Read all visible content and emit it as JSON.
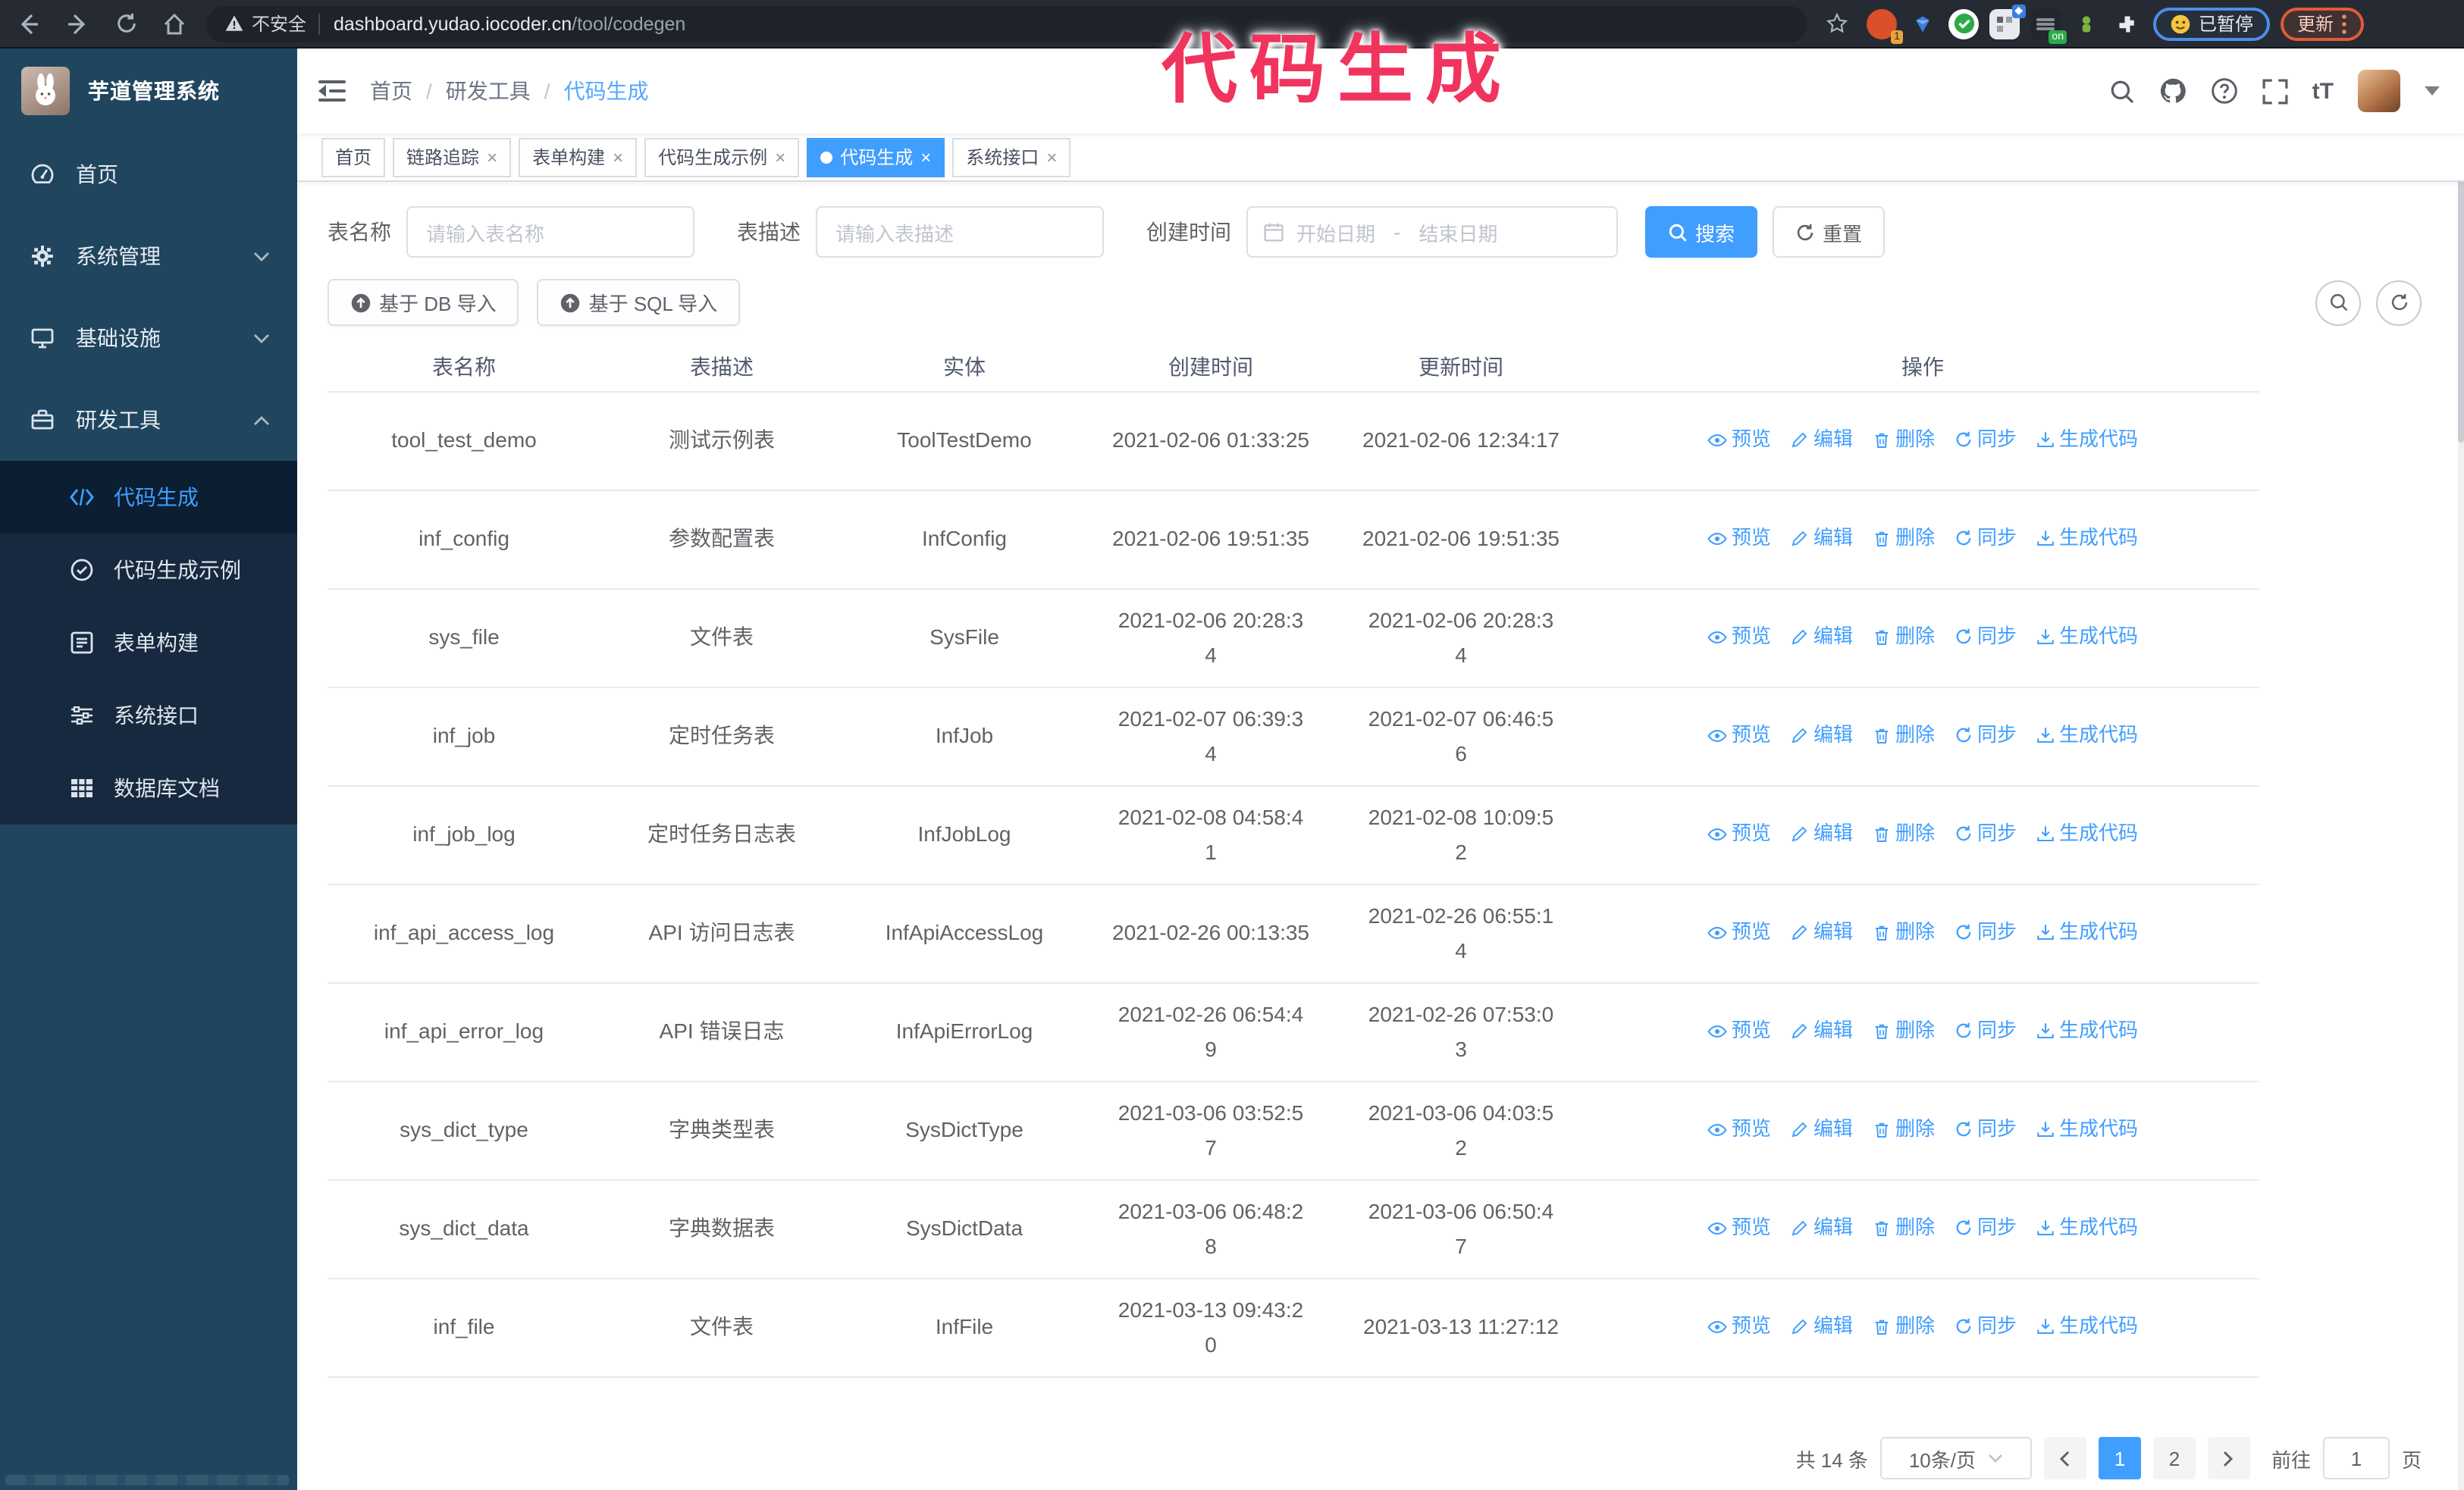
{
  "browser": {
    "security_label": "不安全",
    "url_domain": "dashboard.yudao.iocoder.cn",
    "url_path": "/tool/codegen",
    "ext_badge_count": "1",
    "ext_badge_on": "on",
    "paused_label": "已暂停",
    "update_label": "更新"
  },
  "annotation": {
    "text": "代码生成",
    "color": "#f0345e"
  },
  "app": {
    "title": "芋道管理系统"
  },
  "breadcrumb": [
    "首页",
    "研发工具",
    "代码生成"
  ],
  "sidebar": {
    "items": [
      {
        "label": "首页"
      },
      {
        "label": "系统管理",
        "state": "collapsed"
      },
      {
        "label": "基础设施",
        "state": "collapsed"
      },
      {
        "label": "研发工具",
        "state": "expanded"
      }
    ],
    "submenu": [
      "代码生成",
      "代码生成示例",
      "表单构建",
      "系统接口",
      "数据库文档"
    ],
    "active_submenu": "代码生成"
  },
  "tabs": [
    {
      "label": "首页",
      "closable": false,
      "active": false
    },
    {
      "label": "链路追踪",
      "closable": true,
      "active": false
    },
    {
      "label": "表单构建",
      "closable": true,
      "active": false
    },
    {
      "label": "代码生成示例",
      "closable": true,
      "active": false
    },
    {
      "label": "代码生成",
      "closable": true,
      "active": true
    },
    {
      "label": "系统接口",
      "closable": true,
      "active": false
    }
  ],
  "filters": {
    "table_name_label": "表名称",
    "table_name_placeholder": "请输入表名称",
    "table_desc_label": "表描述",
    "table_desc_placeholder": "请输入表描述",
    "create_time_label": "创建时间",
    "start_placeholder": "开始日期",
    "range_separator": "-",
    "end_placeholder": "结束日期",
    "search_label": "搜索",
    "reset_label": "重置"
  },
  "toolbar": {
    "import_db": "基于 DB 导入",
    "import_sql": "基于 SQL 导入"
  },
  "table": {
    "columns": [
      "表名称",
      "表描述",
      "实体",
      "创建时间",
      "更新时间",
      "操作"
    ],
    "actions": [
      "预览",
      "编辑",
      "删除",
      "同步",
      "生成代码"
    ],
    "rows": [
      {
        "name": "tool_test_demo",
        "desc": "测试示例表",
        "entity": "ToolTestDemo",
        "created": "2021-02-06 01:33:25",
        "updated": "2021-02-06 12:34:17"
      },
      {
        "name": "inf_config",
        "desc": "参数配置表",
        "entity": "InfConfig",
        "created": "2021-02-06 19:51:35",
        "updated": "2021-02-06 19:51:35"
      },
      {
        "name": "sys_file",
        "desc": "文件表",
        "entity": "SysFile",
        "created": "2021-02-06 20:28:34",
        "updated": "2021-02-06 20:28:34"
      },
      {
        "name": "inf_job",
        "desc": "定时任务表",
        "entity": "InfJob",
        "created": "2021-02-07 06:39:34",
        "updated": "2021-02-07 06:46:56"
      },
      {
        "name": "inf_job_log",
        "desc": "定时任务日志表",
        "entity": "InfJobLog",
        "created": "2021-02-08 04:58:41",
        "updated": "2021-02-08 10:09:52"
      },
      {
        "name": "inf_api_access_log",
        "desc": "API 访问日志表",
        "entity": "InfApiAccessLog",
        "created": "2021-02-26 00:13:35",
        "updated": "2021-02-26 06:55:14"
      },
      {
        "name": "inf_api_error_log",
        "desc": "API 错误日志",
        "entity": "InfApiErrorLog",
        "created": "2021-02-26 06:54:49",
        "updated": "2021-02-26 07:53:03"
      },
      {
        "name": "sys_dict_type",
        "desc": "字典类型表",
        "entity": "SysDictType",
        "created": "2021-03-06 03:52:57",
        "updated": "2021-03-06 04:03:52"
      },
      {
        "name": "sys_dict_data",
        "desc": "字典数据表",
        "entity": "SysDictData",
        "created": "2021-03-06 06:48:28",
        "updated": "2021-03-06 06:50:47"
      },
      {
        "name": "inf_file",
        "desc": "文件表",
        "entity": "InfFile",
        "created": "2021-03-13 09:43:20",
        "updated": "2021-03-13 11:27:12"
      }
    ]
  },
  "pagination": {
    "total_label": "共 14 条",
    "page_size_label": "10条/页",
    "pages": [
      "1",
      "2"
    ],
    "active_page": "1",
    "goto_label": "前往",
    "goto_value": "1",
    "page_unit": "页"
  },
  "colors": {
    "accent": "#409eff",
    "sidebar": "#20455e",
    "annotation": "#f0345e"
  }
}
